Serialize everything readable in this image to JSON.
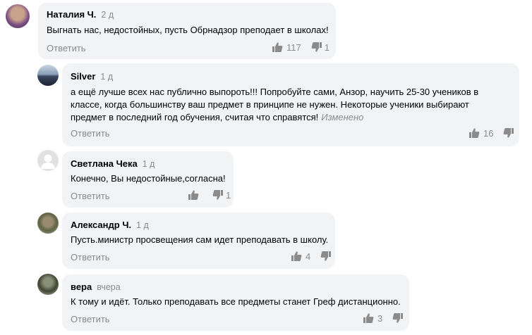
{
  "comments": [
    {
      "author": "Наталия Ч.",
      "time": "2 д",
      "text": "Выгнать нас, недостойных, пусть Обрнадзор преподает в школах!",
      "edited": "",
      "reply_label": "Ответить",
      "likes": "117",
      "dislikes": "1",
      "avatar_colors": [
        "#c9a28b",
        "#7d4e86"
      ]
    },
    {
      "author": "Silver",
      "time": "1 д",
      "text": "а ещё лучше всех нас публично выпороть!!! Попробуйте сами, Анзор, научить 25-30 учеников в классе, когда большинству ваш предмет в принципе не нужен. Некоторые ученики выбирают предмет в последний год обучения, считая что справятся!",
      "edited": "Изменено",
      "reply_label": "Ответить",
      "likes": "16",
      "dislikes": "",
      "avatar_colors": [
        "#5a6b86",
        "#c9d6e0"
      ]
    },
    {
      "author": "Светлана Чека",
      "time": "1 д",
      "text": "Конечно, Вы недостойные,согласна!",
      "edited": "",
      "reply_label": "Ответить",
      "likes": "",
      "dislikes": "1",
      "avatar_colors": [
        "#d9d9d9",
        "#ffffff"
      ]
    },
    {
      "author": "Александр Ч.",
      "time": "1 д",
      "text": "Пусть.министр просвещения сам идет преподавать в школу.",
      "edited": "",
      "reply_label": "Ответить",
      "likes": "4",
      "dislikes": "",
      "avatar_colors": [
        "#6b6b4f",
        "#a8b0a0"
      ]
    },
    {
      "author": "вера",
      "time": "вчера",
      "text": "К тому и идёт. Только преподавать все предметы станет Греф дистанционно.",
      "edited": "",
      "reply_label": "Ответить",
      "likes": "3",
      "dislikes": "",
      "avatar_colors": [
        "#4a4f3a",
        "#b9bea8"
      ]
    }
  ]
}
